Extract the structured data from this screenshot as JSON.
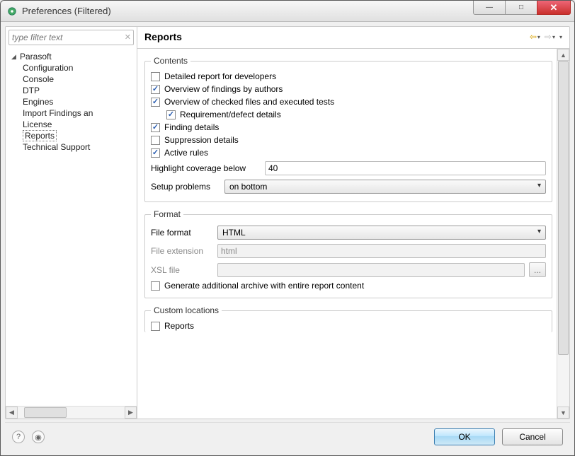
{
  "window": {
    "title": "Preferences (Filtered)"
  },
  "filter": {
    "placeholder": "type filter text"
  },
  "tree": {
    "root": "Parasoft",
    "items": [
      "Configuration",
      "Console",
      "DTP",
      "Engines",
      "Import Findings an",
      "License",
      "Reports",
      "Technical Support"
    ],
    "selected_index": 6
  },
  "page": {
    "title": "Reports"
  },
  "contents": {
    "legend": "Contents",
    "checkboxes": [
      {
        "label": "Detailed report for developers",
        "checked": false,
        "indent": false
      },
      {
        "label": "Overview of findings by authors",
        "checked": true,
        "indent": false
      },
      {
        "label": "Overview of checked files and executed tests",
        "checked": true,
        "indent": false
      },
      {
        "label": "Requirement/defect details",
        "checked": true,
        "indent": true
      },
      {
        "label": "Finding details",
        "checked": true,
        "indent": false
      },
      {
        "label": "Suppression details",
        "checked": false,
        "indent": false
      },
      {
        "label": "Active rules",
        "checked": true,
        "indent": false
      }
    ],
    "highlight_label": "Highlight coverage below",
    "highlight_value": "40",
    "setup_label": "Setup problems",
    "setup_value": "on bottom"
  },
  "format": {
    "legend": "Format",
    "file_format_label": "File format",
    "file_format_value": "HTML",
    "file_ext_label": "File extension",
    "file_ext_value": "html",
    "xsl_label": "XSL file",
    "xsl_value": "",
    "browse": "...",
    "archive_label": "Generate additional archive with entire report content",
    "archive_checked": false
  },
  "custom": {
    "legend": "Custom locations",
    "reports_label": "Reports",
    "reports_checked": false
  },
  "buttons": {
    "ok": "OK",
    "cancel": "Cancel"
  }
}
